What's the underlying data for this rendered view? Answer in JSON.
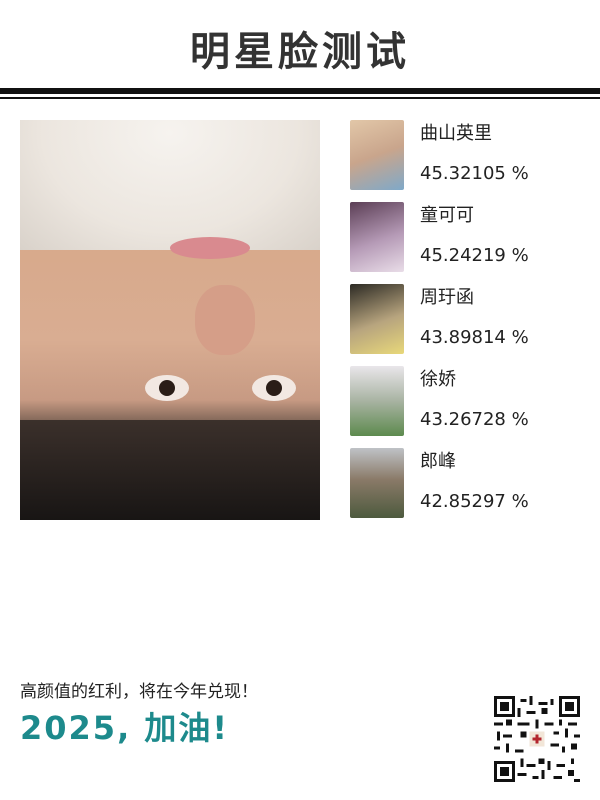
{
  "header": {
    "title": "明星脸测试"
  },
  "results": [
    {
      "name": "曲山英里",
      "score": "45.32105 %",
      "thumb_color": "#c9a58c"
    },
    {
      "name": "童可可",
      "score": "45.24219 %",
      "thumb_color": "#b59ab6"
    },
    {
      "name": "周玗函",
      "score": "43.89814 %",
      "thumb_color": "#b7a47e"
    },
    {
      "name": "徐娇",
      "score": "43.26728 %",
      "thumb_color": "#a8b3a2"
    },
    {
      "name": "郎峰",
      "score": "42.85297 %",
      "thumb_color": "#8a7a68"
    }
  ],
  "footer": {
    "slogan": "高颜值的红利，将在今年兑现！",
    "cheer": "2025, 加油!"
  },
  "colors": {
    "accent": "#1d8a8c",
    "rule": "#111111"
  },
  "icons": {
    "qr": "qr-code-icon"
  }
}
